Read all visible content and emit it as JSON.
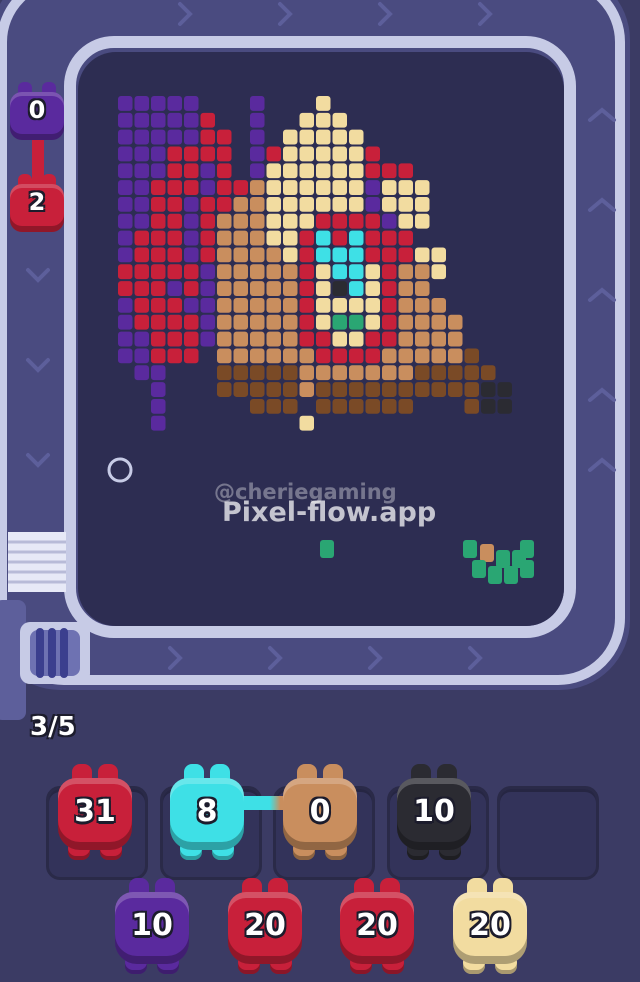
{
  "watermark": {
    "handle": "@cheriegaming",
    "site": "Pixel-flow.app"
  },
  "slot_counter": "3/5",
  "colors": {
    "purple": "#5a2a9e",
    "red": "#c8203a",
    "cream": "#f2dca0",
    "tan": "#c98e5e",
    "brown": "#7a4a26",
    "cyan": "#3ee0e6",
    "green": "#2aa673",
    "black": "#2b2b32",
    "track": "#c7cbe6",
    "board": "#2d2d52",
    "background": "#3b3b64"
  },
  "conveyor_shooters": [
    {
      "count": "0",
      "color": "purple"
    },
    {
      "count": "2",
      "color": "red"
    }
  ],
  "active_slots": [
    {
      "count": "31",
      "color": "red"
    },
    {
      "count": "8",
      "color": "cyan"
    },
    {
      "count": "0",
      "color": "tan"
    },
    {
      "count": "10",
      "color": "black"
    },
    {
      "count": "",
      "color": ""
    }
  ],
  "queue": [
    {
      "count": "10",
      "color": "purple"
    },
    {
      "count": "20",
      "color": "red"
    },
    {
      "count": "20",
      "color": "red"
    },
    {
      "count": "20",
      "color": "cream"
    }
  ]
}
